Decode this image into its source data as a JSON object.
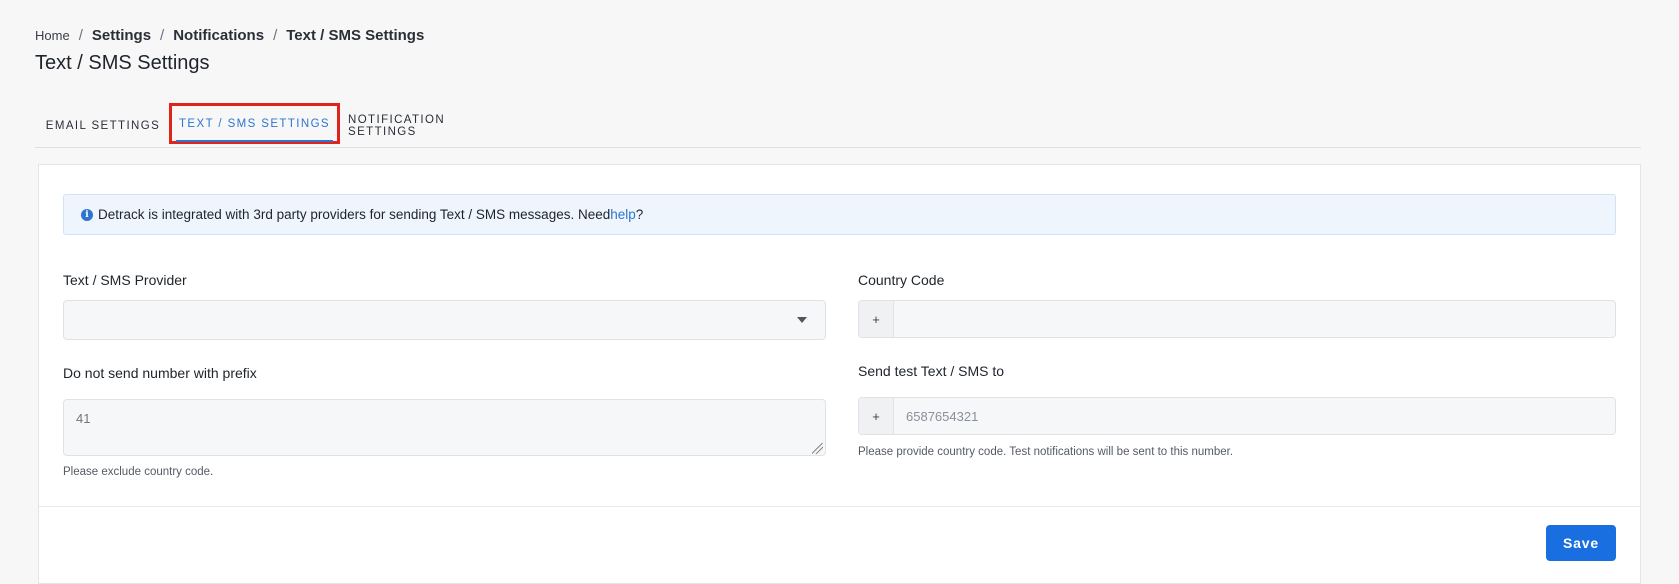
{
  "breadcrumb": {
    "items": [
      "Home",
      "Settings",
      "Notifications",
      "Text / SMS Settings"
    ],
    "separator": "/"
  },
  "page": {
    "title": "Text / SMS Settings"
  },
  "tabs": [
    {
      "label": "EMAIL SETTINGS",
      "active": false
    },
    {
      "label": "TEXT / SMS SETTINGS",
      "active": true
    },
    {
      "label": "NOTIFICATION SETTINGS",
      "active": false
    }
  ],
  "info": {
    "text_before": "Detrack is integrated with 3rd party providers for sending Text / SMS messages. Need ",
    "link": "help",
    "text_after": "?"
  },
  "form": {
    "provider": {
      "label": "Text / SMS Provider",
      "value": ""
    },
    "country_code": {
      "label": "Country Code",
      "prefix": "+",
      "value": ""
    },
    "prefix": {
      "label": "Do not send number with prefix",
      "placeholder": "41",
      "help": "Please exclude country code."
    },
    "test": {
      "label": "Send test Text / SMS to",
      "prefix": "+",
      "placeholder": "6587654321",
      "help": "Please provide country code. Test notifications will be sent to this number."
    }
  },
  "actions": {
    "save_label": "Save"
  },
  "colors": {
    "accent": "#2f74d0",
    "button": "#1a6fe0",
    "highlight": "#e0241b"
  }
}
